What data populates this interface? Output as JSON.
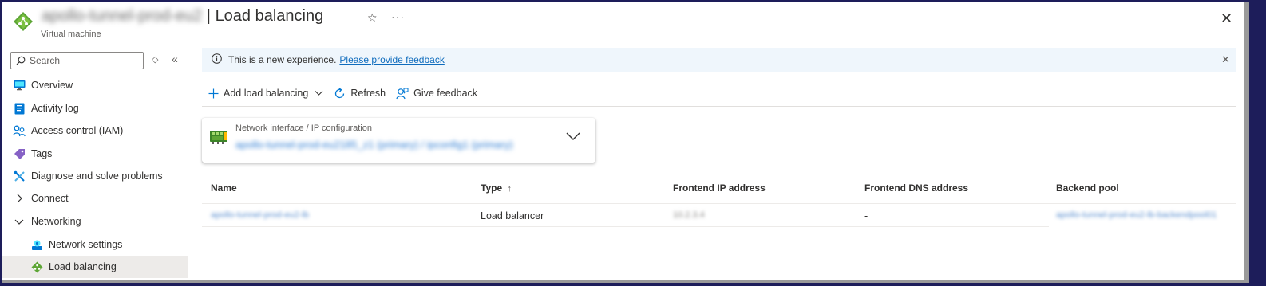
{
  "header": {
    "resource_name": "apollo-tunnel-prod-eu2",
    "separator": " | ",
    "page_title": "Load balancing",
    "resource_type": "Virtual machine",
    "star_glyph": "☆",
    "more_glyph": "···",
    "close_glyph": "✕"
  },
  "sidebar": {
    "search_placeholder": "Search",
    "collapse_glyph": "«",
    "toggle_glyph": "◇",
    "items": [
      {
        "label": "Overview"
      },
      {
        "label": "Activity log"
      },
      {
        "label": "Access control (IAM)"
      },
      {
        "label": "Tags"
      },
      {
        "label": "Diagnose and solve problems"
      },
      {
        "label": "Connect"
      },
      {
        "label": "Networking"
      },
      {
        "label": "Network settings"
      },
      {
        "label": "Load balancing"
      }
    ]
  },
  "banner": {
    "text": "This is a new experience.",
    "link": "Please provide feedback"
  },
  "toolbar": {
    "add_label": "Add load balancing",
    "refresh_label": "Refresh",
    "feedback_label": "Give feedback"
  },
  "ip_config": {
    "label": "Network interface / IP configuration",
    "value": "apollo-tunnel-prod-eu2185_z1 (primary) / ipconfig1 (primary)"
  },
  "table": {
    "columns": [
      "Name",
      "Type",
      "Frontend IP address",
      "Frontend DNS address",
      "Backend pool"
    ],
    "sort_glyph": "↑",
    "rows": [
      {
        "name": "apollo-tunnel-prod-eu2-lb",
        "type": "Load balancer",
        "frontend_ip": "10.2.3.4",
        "frontend_dns": "-",
        "backend_pool": "apollo-tunnel-prod-eu2-lb-backendpool01"
      }
    ]
  },
  "colors": {
    "accent": "#0f6cbd",
    "banner_bg": "#eff6fc",
    "active_nav_bg": "#edebe9"
  }
}
